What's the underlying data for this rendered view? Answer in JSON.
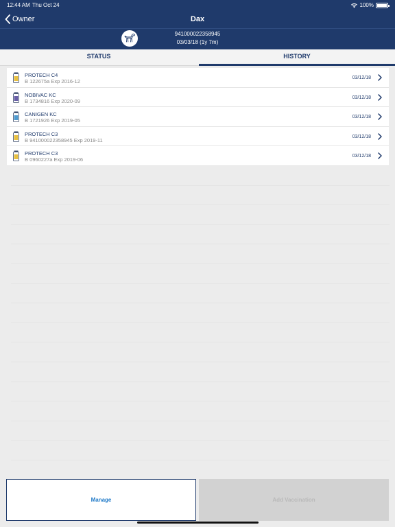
{
  "status_bar": {
    "time": "12:44 AM",
    "date": "Thu Oct 24",
    "battery": "100%"
  },
  "nav": {
    "back_label": "Owner",
    "title": "Dax"
  },
  "pet": {
    "chip": "941000022358945",
    "dob": "03/03/18 (1y 7m)"
  },
  "tabs": [
    {
      "label": "STATUS"
    },
    {
      "label": "HISTORY"
    }
  ],
  "history": [
    {
      "name": "PROTECH C4",
      "detail": "B 122675a Exp 2016-12",
      "date": "03/12/18",
      "vial_color": "#e8c040"
    },
    {
      "name": "NOBIVAC KC",
      "detail": "B 1734816 Exp 2020-09",
      "date": "03/12/18",
      "vial_color": "#6a5fa8"
    },
    {
      "name": "CANIGEN KC",
      "detail": "B 1721926 Exp 2019-05",
      "date": "03/12/18",
      "vial_color": "#4f9bd0"
    },
    {
      "name": "PROTECH C3",
      "detail": "B 941000022358945 Exp 2019-11",
      "date": "03/12/18",
      "vial_color": "#e8c040"
    },
    {
      "name": "PROTECH C3",
      "detail": "B 0960227a Exp 2019-06",
      "date": "03/12/18",
      "vial_color": "#e8c040"
    }
  ],
  "buttons": {
    "manage": "Manage",
    "add": "Add Vaccination"
  },
  "colors": {
    "navy": "#1f3a6b",
    "link_blue": "#1f7ac8"
  }
}
